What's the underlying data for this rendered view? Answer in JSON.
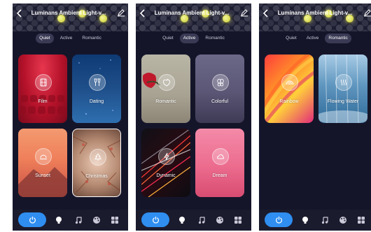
{
  "app": {
    "title": "Luminans Ambient Light-v...",
    "tabs": [
      "Quiet",
      "Active",
      "Romantic"
    ]
  },
  "screens": [
    {
      "active_tab": "Quiet",
      "cards": [
        {
          "label": "Film",
          "icon": "film-icon"
        },
        {
          "label": "Dating",
          "icon": "champagne-glasses-icon"
        },
        {
          "label": "Sunset",
          "icon": "sunset-icon"
        },
        {
          "label": "Christmas",
          "icon": "christmas-tree-icon",
          "selected": true
        }
      ]
    },
    {
      "active_tab": "Active",
      "cards": [
        {
          "label": "Romantic",
          "icon": "apple-heart-icon"
        },
        {
          "label": "Colorful",
          "icon": "balloons-icon"
        },
        {
          "label": "Dynamic",
          "icon": "lightning-icon"
        },
        {
          "label": "Dream",
          "icon": "cloud-icon"
        }
      ]
    },
    {
      "active_tab": "Romantic",
      "cards": [
        {
          "label": "Rainbow",
          "icon": "rainbow-icon"
        },
        {
          "label": "Flowing Water",
          "icon": "water-waves-icon"
        }
      ]
    }
  ],
  "bottom_nav": [
    "power-icon",
    "bulb-icon",
    "music-icon",
    "palette-icon",
    "grid-icon"
  ],
  "colors": {
    "accent": "#2f8ef0",
    "background": "#15152a",
    "indicator": "#e6ea5a"
  }
}
